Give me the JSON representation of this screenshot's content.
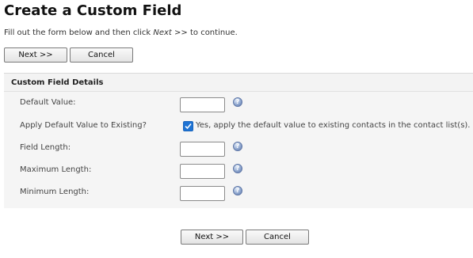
{
  "page": {
    "title": "Create a Custom Field",
    "intro_before": "Fill out the form below and then click ",
    "intro_emphasis": "Next >>",
    "intro_after": " to continue."
  },
  "top_actions": {
    "next_label": "Next >>",
    "cancel_label": "Cancel"
  },
  "panel": {
    "title": "Custom Field Details",
    "fields": {
      "default_value": {
        "label": "Default Value:",
        "value": ""
      },
      "apply_default": {
        "label": "Apply Default Value to Existing?",
        "checked": true,
        "checkbox_label": "Yes, apply the default value to existing contacts in the contact list(s)."
      },
      "field_length": {
        "label": "Field Length:",
        "value": ""
      },
      "maximum_length": {
        "label": "Maximum Length:",
        "value": ""
      },
      "minimum_length": {
        "label": "Minimum Length:",
        "value": ""
      }
    },
    "help_icon_name": "help-icon"
  },
  "bottom_actions": {
    "next_label": "Next >>",
    "cancel_label": "Cancel"
  },
  "colors": {
    "checkbox_accent": "#1e73d4",
    "help_icon": "#7b93c2"
  }
}
